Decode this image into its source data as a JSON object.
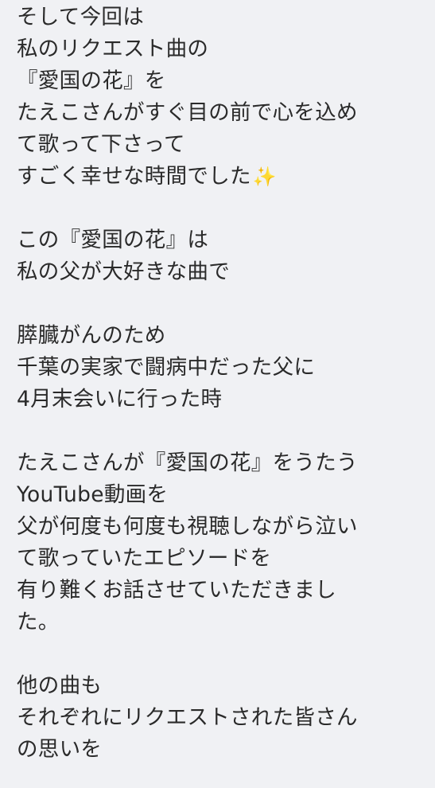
{
  "post": {
    "paragraphs": [
      {
        "lines": [
          "そして今回は",
          "私のリクエスト曲の",
          "『愛国の花』を",
          "たえこさんがすぐ目の前で心を込め",
          "て歌って下さって",
          "すごく幸せな時間でした"
        ],
        "trailing_emoji": "✨"
      },
      {
        "lines": [
          "この『愛国の花』は",
          "私の父が大好きな曲で"
        ]
      },
      {
        "lines": [
          "膵臓がんのため",
          "千葉の実家で闘病中だった父に",
          "4月末会いに行った時"
        ]
      },
      {
        "lines": [
          "たえこさんが『愛国の花』をうたう",
          "YouTube動画を",
          "父が何度も何度も視聴しながら泣い",
          "て歌っていたエピソードを",
          "有り難くお話させていただきまし",
          "た。"
        ]
      },
      {
        "lines": [
          "他の曲も",
          "それぞれにリクエストされた皆さん",
          "の思いを"
        ]
      }
    ]
  },
  "colors": {
    "background": "#f0f1f4",
    "text": "#2a2a2a",
    "sparkle": "#f2b705"
  }
}
